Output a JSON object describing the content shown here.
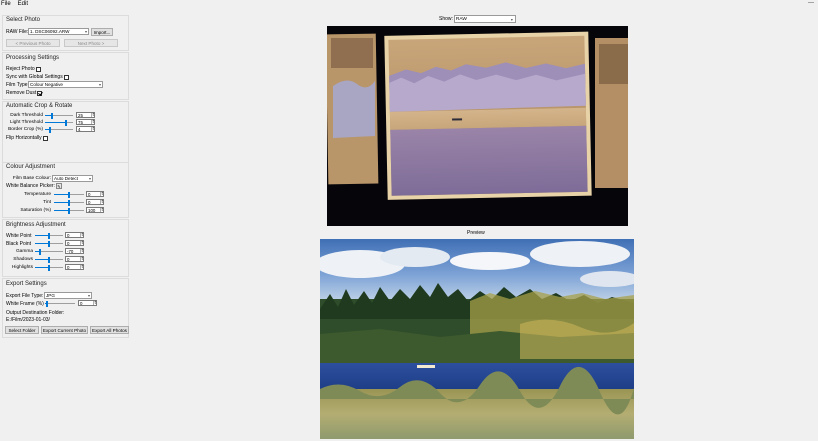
{
  "menu": {
    "file": "File",
    "edit": "Edit"
  },
  "select_photo": {
    "title": "Select Photo",
    "raw_file_label": "RAW File:",
    "raw_file_value": "1. DSC06092.ARW",
    "import_button": "Import...",
    "prev_button": "< Previous Photo",
    "next_button": "Next Photo >"
  },
  "processing": {
    "title": "Processing Settings",
    "reject_label": "Reject Photo",
    "reject_checked": false,
    "sync_label": "Sync with Global Settings",
    "sync_checked": false,
    "film_type_label": "Film Type:",
    "film_type_value": "Colour Negative",
    "remove_dust_label": "Remove Dust",
    "remove_dust_checked": true
  },
  "crop": {
    "title": "Automatic Crop & Rotate",
    "dark_label": "Dark Threshold",
    "dark_value": "25",
    "light_label": "Light Threshold",
    "light_value": "75",
    "border_label": "Border Crop (%)",
    "border_value": "4",
    "flip_label": "Flip Horizontally",
    "flip_checked": false,
    "rotate_ccw_button": "Rotate Counterclockwise",
    "rotate_cw_button": "Rotate Clockwise"
  },
  "colour": {
    "title": "Colour Adjustment",
    "film_base_label": "Film Base Colour:",
    "film_base_value": "Auto Detect",
    "wb_picker_label": "White Balance Picker:",
    "temperature_label": "Temperature",
    "temperature_value": "0",
    "tint_label": "Tint",
    "tint_value": "0",
    "saturation_label": "Saturation (%)",
    "saturation_value": "100"
  },
  "brightness": {
    "title": "Brightness Adjustment",
    "white_point_label": "White Point",
    "white_point_value": "0",
    "black_point_label": "Black Point",
    "black_point_value": "0",
    "gamma_label": "Gamma",
    "gamma_value": "-70",
    "shadows_label": "Shadows",
    "shadows_value": "0",
    "highlights_label": "Highlights",
    "highlights_value": "0"
  },
  "export": {
    "title": "Export Settings",
    "file_type_label": "Export File Type:",
    "file_type_value": "JPG",
    "white_frame_label": "White Frame (%)",
    "white_frame_value": "0",
    "dest_label": "Output Destination Folder:",
    "dest_value": "E:/Film/2023-01-03/",
    "select_folder_button": "Select Folder",
    "export_current_button": "Export Current Photo",
    "export_all_button": "Export All Photos"
  },
  "view": {
    "label": "Show:",
    "value": "RAW"
  },
  "preview_label": "Preview",
  "colors": {
    "slider_accent": "#0078d7",
    "window_bg": "#f0f0f0"
  }
}
